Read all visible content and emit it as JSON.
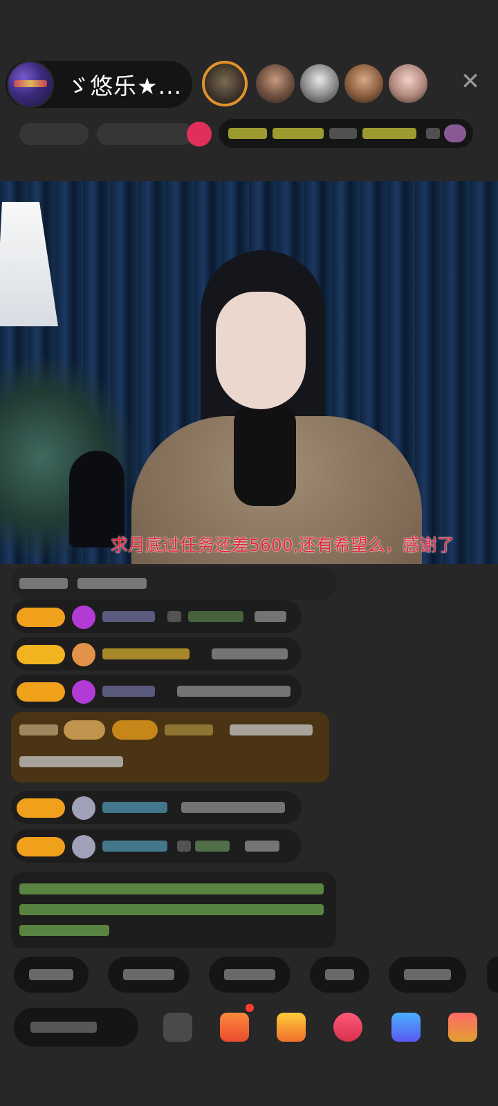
{
  "host": {
    "name": "ゞ悠乐★..."
  },
  "viewers": [
    "top-viewer",
    "viewer-2",
    "viewer-3",
    "viewer-4",
    "viewer-5"
  ],
  "controls": {
    "close_symbol": "✕"
  },
  "stream": {
    "subtitle": "求月底过任务还差5600,还有希望么，感谢了"
  },
  "colors": {
    "background": "#272727",
    "subtitle": "#e8263b",
    "level_badge": "#f0a11c",
    "gift_banner": "#4a3414"
  },
  "icons": [
    "close-icon",
    "gift-icon",
    "fans-club-icon",
    "treasure-icon",
    "game-icon",
    "more-icon",
    "emoji-icon"
  ]
}
